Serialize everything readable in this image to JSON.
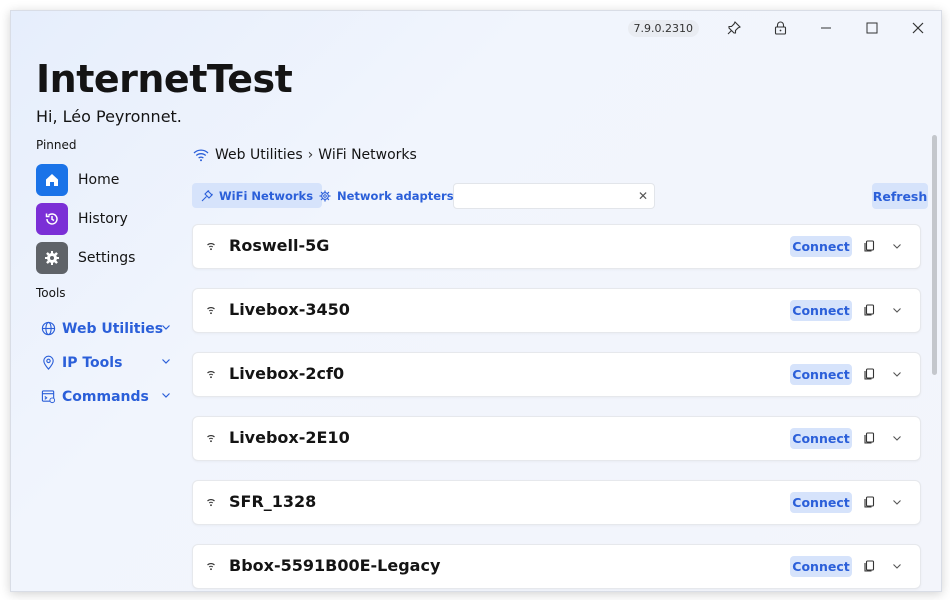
{
  "titlebar": {
    "version": "7.9.0.2310",
    "pin_icon": "pin-icon",
    "lock_icon": "lock-icon",
    "minimize_icon": "minimize-icon",
    "maximize_icon": "maximize-icon",
    "close_icon": "close-icon"
  },
  "header": {
    "app_title": "InternetTest",
    "greeting": "Hi, Léo Peyronnet."
  },
  "sidebar": {
    "pinned_label": "Pinned",
    "pinned": [
      {
        "label": "Home",
        "icon": "home-icon",
        "color": "#1a73e8"
      },
      {
        "label": "History",
        "icon": "history-icon",
        "color": "#7b2fd6"
      },
      {
        "label": "Settings",
        "icon": "gear-icon",
        "color": "#5f6368"
      }
    ],
    "tools_label": "Tools",
    "tools": [
      {
        "label": "Web Utilities",
        "icon": "globe-icon"
      },
      {
        "label": "IP Tools",
        "icon": "location-pin-icon"
      },
      {
        "label": "Commands",
        "icon": "command-icon"
      }
    ]
  },
  "main": {
    "breadcrumb": {
      "parent": "Web Utilities",
      "separator": "›",
      "current": "WiFi Networks"
    },
    "tabs": [
      {
        "label": "WiFi Networks",
        "icon": "plug-icon",
        "active": true
      },
      {
        "label": "Network adapters",
        "icon": "gear-icon",
        "active": false
      }
    ],
    "search": {
      "value": "",
      "placeholder": ""
    },
    "refresh_label": "Refresh",
    "networks": [
      {
        "ssid": "Roswell-5G",
        "connect_label": "Connect",
        "signal": "wifi-icon"
      },
      {
        "ssid": "Livebox-3450",
        "connect_label": "Connect",
        "signal": "wifi-icon"
      },
      {
        "ssid": "Livebox-2cf0",
        "connect_label": "Connect",
        "signal": "wifi-icon"
      },
      {
        "ssid": "Livebox-2E10",
        "connect_label": "Connect",
        "signal": "wifi-icon"
      },
      {
        "ssid": "SFR_1328",
        "connect_label": "Connect",
        "signal": "wifi-icon"
      },
      {
        "ssid": "Bbox-5591B00E-Legacy",
        "connect_label": "Connect",
        "signal": "wifi-icon"
      }
    ]
  },
  "colors": {
    "accent": "#2b5fd9",
    "accent_bg": "#d6e3fb"
  }
}
